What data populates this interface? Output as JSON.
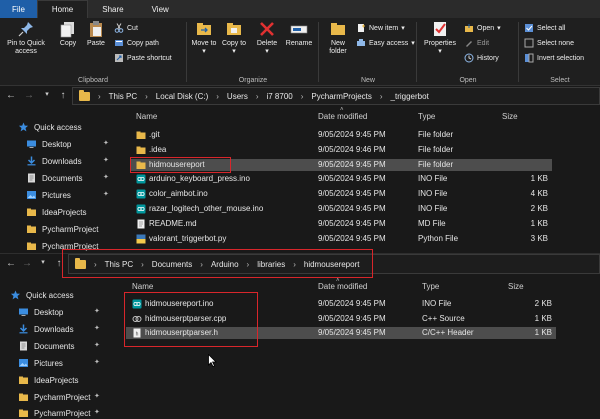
{
  "ribbon": {
    "tabs": [
      "File",
      "Home",
      "Share",
      "View"
    ],
    "clipboard": {
      "label": "Clipboard",
      "pin": "Pin to Quick access",
      "copy": "Copy",
      "paste": "Paste",
      "cut": "Cut",
      "copy_path": "Copy path",
      "paste_shortcut": "Paste shortcut"
    },
    "organize": {
      "label": "Organize",
      "move_to": "Move to",
      "copy_to": "Copy to",
      "delete": "Delete",
      "rename": "Rename"
    },
    "new": {
      "label": "New",
      "new_folder": "New folder",
      "new_item": "New item",
      "easy_access": "Easy access"
    },
    "open": {
      "label": "Open",
      "properties": "Properties",
      "open": "Open",
      "edit": "Edit",
      "history": "History"
    },
    "select": {
      "label": "Select",
      "select_all": "Select all",
      "select_none": "Select none",
      "invert": "Invert selection"
    }
  },
  "window1": {
    "breadcrumb": [
      "This PC",
      "Local Disk (C:)",
      "Users",
      "i7 8700",
      "PycharmProjects",
      "_triggerbot"
    ],
    "columns": {
      "name": "Name",
      "date": "Date modified",
      "type": "Type",
      "size": "Size"
    },
    "nav": [
      {
        "label": "Quick access",
        "icon": "star-icon"
      },
      {
        "label": "Desktop",
        "icon": "desktop-icon"
      },
      {
        "label": "Downloads",
        "icon": "download-icon"
      },
      {
        "label": "Documents",
        "icon": "documents-icon"
      },
      {
        "label": "Pictures",
        "icon": "pictures-icon"
      },
      {
        "label": "IdeaProjects",
        "icon": "folder-icon"
      },
      {
        "label": "PycharmProject",
        "icon": "folder-icon"
      },
      {
        "label": "PycharmProject",
        "icon": "folder-icon"
      }
    ],
    "files": [
      {
        "name": ".git",
        "date": "9/05/2024 9:45 PM",
        "type": "File folder",
        "size": "",
        "icon": "folder-icon"
      },
      {
        "name": ".idea",
        "date": "9/05/2024 9:46 PM",
        "type": "File folder",
        "size": "",
        "icon": "folder-icon"
      },
      {
        "name": "hidmousereport",
        "date": "9/05/2024 9:45 PM",
        "type": "File folder",
        "size": "",
        "icon": "folder-icon"
      },
      {
        "name": "arduino_keyboard_press.ino",
        "date": "9/05/2024 9:45 PM",
        "type": "INO File",
        "size": "1 KB",
        "icon": "ino-file-icon"
      },
      {
        "name": "color_aimbot.ino",
        "date": "9/05/2024 9:45 PM",
        "type": "INO File",
        "size": "4 KB",
        "icon": "ino-file-icon"
      },
      {
        "name": "razar_logitech_other_mouse.ino",
        "date": "9/05/2024 9:45 PM",
        "type": "INO File",
        "size": "2 KB",
        "icon": "ino-file-icon"
      },
      {
        "name": "README.md",
        "date": "9/05/2024 9:45 PM",
        "type": "MD File",
        "size": "1 KB",
        "icon": "text-file-icon"
      },
      {
        "name": "valorant_triggerbot.py",
        "date": "9/05/2024 9:45 PM",
        "type": "Python File",
        "size": "3 KB",
        "icon": "python-file-icon"
      }
    ]
  },
  "window2": {
    "breadcrumb": [
      "This PC",
      "Documents",
      "Arduino",
      "libraries",
      "hidmousereport"
    ],
    "columns": {
      "name": "Name",
      "date": "Date modified",
      "type": "Type",
      "size": "Size"
    },
    "nav": [
      {
        "label": "Quick access",
        "icon": "star-icon"
      },
      {
        "label": "Desktop",
        "icon": "desktop-icon"
      },
      {
        "label": "Downloads",
        "icon": "download-icon"
      },
      {
        "label": "Documents",
        "icon": "documents-icon"
      },
      {
        "label": "Pictures",
        "icon": "pictures-icon"
      },
      {
        "label": "IdeaProjects",
        "icon": "folder-icon"
      },
      {
        "label": "PycharmProject",
        "icon": "folder-icon"
      },
      {
        "label": "PycharmProject",
        "icon": "folder-icon"
      }
    ],
    "files": [
      {
        "name": "hidmousereport.ino",
        "date": "9/05/2024 9:45 PM",
        "type": "INO File",
        "size": "2 KB",
        "icon": "ino-file-icon"
      },
      {
        "name": "hidmouserptparser.cpp",
        "date": "9/05/2024 9:45 PM",
        "type": "C++ Source",
        "size": "1 KB",
        "icon": "cpp-file-icon"
      },
      {
        "name": "hidmouserptparser.h",
        "date": "9/05/2024 9:45 PM",
        "type": "C/C++ Header",
        "size": "1 KB",
        "icon": "header-file-icon"
      }
    ]
  },
  "colors": {
    "background": "#191919",
    "ribbon": "#1f1f1f",
    "file_tab": "#1f5fa8",
    "selection": "#4d4d4d",
    "highlight_box": "#d8262b",
    "folder": "#e8b84a"
  }
}
